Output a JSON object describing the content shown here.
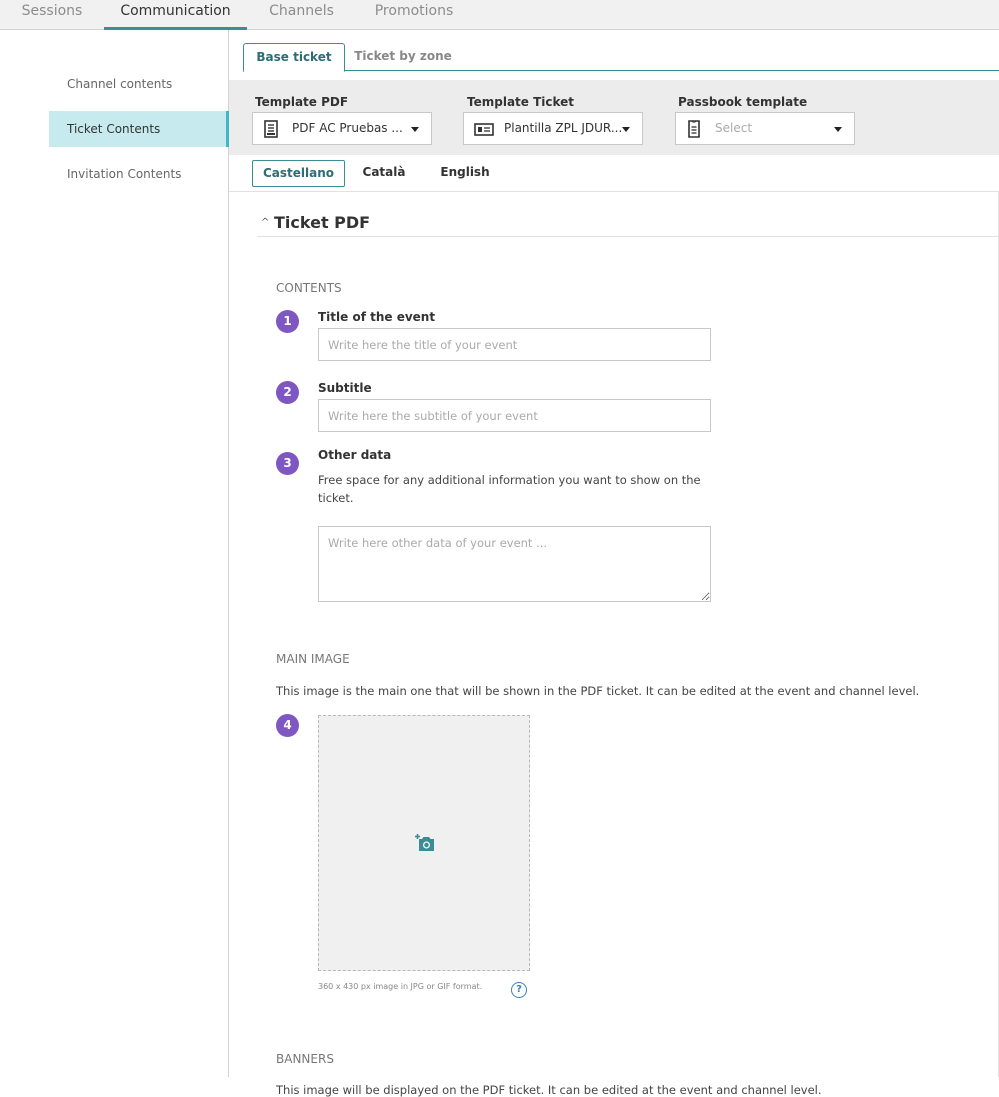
{
  "topnav": {
    "tabs": [
      {
        "label": "Sessions"
      },
      {
        "label": "Communication"
      },
      {
        "label": "Channels"
      },
      {
        "label": "Promotions"
      }
    ]
  },
  "sidebar": {
    "items": [
      {
        "label": "Channel contents"
      },
      {
        "label": "Ticket Contents"
      },
      {
        "label": "Invitation Contents"
      }
    ]
  },
  "subtabs": [
    {
      "label": "Base ticket"
    },
    {
      "label": "Ticket by zone"
    }
  ],
  "templates": {
    "pdf": {
      "label": "Template PDF",
      "value": "PDF AC Pruebas ...",
      "icon": "document-icon"
    },
    "ticket": {
      "label": "Template Ticket",
      "value": "Plantilla ZPL JDUR...",
      "icon": "ticket-icon"
    },
    "passbook": {
      "label": "Passbook template",
      "placeholder": "Select",
      "icon": "passbook-icon"
    }
  },
  "languages": [
    {
      "label": "Castellano"
    },
    {
      "label": "Català"
    },
    {
      "label": "English"
    }
  ],
  "section": {
    "title": "Ticket PDF",
    "contents_heading": "CONTENTS",
    "fields": {
      "title": {
        "number": "1",
        "label": "Title of the event",
        "placeholder": "Write here the title of your event"
      },
      "subtitle": {
        "number": "2",
        "label": "Subtitle",
        "placeholder": "Write here the subtitle of your event"
      },
      "other": {
        "number": "3",
        "label": "Other data",
        "help": "Free space for any additional information you want to show on the ticket.",
        "placeholder": "Write here other data of your event ..."
      }
    },
    "main_image": {
      "heading": "MAIN IMAGE",
      "description": "This image is the main one that will be shown in the PDF ticket. It can be edited at the event and channel level.",
      "number": "4",
      "note": "360 x 430 px image in JPG or GIF format.",
      "help_glyph": "?"
    },
    "banners": {
      "heading": "BANNERS",
      "description": "This image will be displayed on the PDF ticket. It can be edited at the event and channel level."
    }
  },
  "colors": {
    "accent": "#3b8c95",
    "step_badge": "#7e57c2",
    "sidebar_active": "#c6eaee"
  }
}
